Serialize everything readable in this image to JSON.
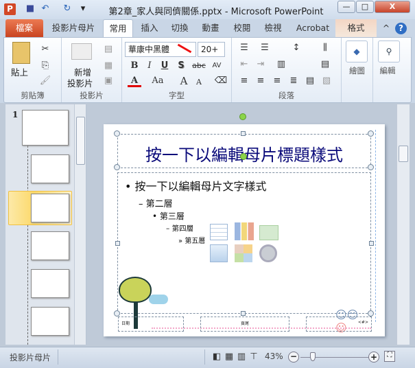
{
  "window": {
    "title": "第2章_家人與同儕關係.pptx - Microsoft PowerPoint",
    "app_icon": "P",
    "minimize": "—",
    "maximize": "□",
    "close": "X"
  },
  "qat": {
    "save_icon": "save-icon",
    "undo": "↶",
    "redo": "↻",
    "customize": "▾"
  },
  "tabs": [
    {
      "label": "檔案",
      "active": false
    },
    {
      "label": "投影片母片"
    },
    {
      "label": "常用",
      "active": true
    },
    {
      "label": "插入"
    },
    {
      "label": "切換"
    },
    {
      "label": "動畫"
    },
    {
      "label": "校閱"
    },
    {
      "label": "檢視"
    },
    {
      "label": "Acrobat"
    },
    {
      "label": "格式"
    }
  ],
  "help": "?",
  "collapse": "^",
  "ribbon": {
    "clipboard": {
      "label": "剪貼簿",
      "paste": "貼上"
    },
    "slides": {
      "label": "投影片",
      "new_slide_line1": "新增",
      "new_slide_line2": "投影片"
    },
    "font": {
      "label": "字型",
      "font_name": "華康中黑體",
      "font_size": "20+",
      "bold": "B",
      "italic": "I",
      "underline": "U",
      "shadow": "S",
      "strike": "abc",
      "spacing": "AV",
      "color": "A",
      "case": "Aa",
      "grow": "A",
      "shrink": "A"
    },
    "paragraph": {
      "label": "段落"
    },
    "drawing": {
      "label": "繪圖"
    },
    "editing": {
      "label": "編輯"
    }
  },
  "colors": {
    "file_tab": "#d9502b",
    "title_text": "#0a0a7a",
    "font_color_bar": "#e00000",
    "selected_thumb": "#fbd96b"
  },
  "thumbnails": {
    "master_number": "1",
    "selected_index": 2
  },
  "slide": {
    "title": "按一下以編輯母片標題樣式",
    "levels": [
      "按一下以編輯母片文字樣式",
      "第二層",
      "第三層",
      "第四層",
      "第五層"
    ],
    "bullets": [
      "•",
      "–",
      "•",
      "–",
      "»"
    ],
    "footer": {
      "date": "日期",
      "footer": "頁尾",
      "number": "<#>"
    }
  },
  "status": {
    "view": "投影片母片",
    "zoom": "43%",
    "zoom_fraction": 0.43
  }
}
